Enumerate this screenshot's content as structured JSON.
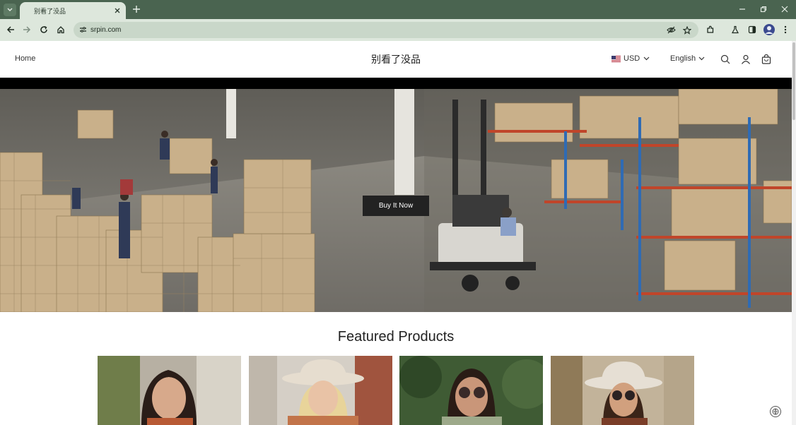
{
  "browser": {
    "tab_title": "别看了没品",
    "url": "srpin.com",
    "icons": [
      "tab-list-icon",
      "close-icon",
      "new-tab-icon",
      "minimize-icon",
      "restore-icon",
      "window-close-icon",
      "back-icon",
      "forward-icon",
      "reload-icon",
      "home-icon",
      "site-info-icon",
      "eye-off-icon",
      "star-icon",
      "extensions-icon",
      "labs-icon",
      "sidebar-icon",
      "profile-icon",
      "menu-icon"
    ]
  },
  "header": {
    "home_label": "Home",
    "logo": "别看了没品",
    "currency": "USD",
    "language": "English",
    "icons": [
      "search-icon",
      "account-icon",
      "cart-icon"
    ]
  },
  "hero": {
    "button_label": "Buy It Now"
  },
  "featured": {
    "title": "Featured Products",
    "products": [
      {
        "name": "product-1"
      },
      {
        "name": "product-2"
      },
      {
        "name": "product-3"
      },
      {
        "name": "product-4"
      }
    ]
  },
  "colors": {
    "chrome_dark": "#4a6450",
    "chrome_light": "#dde7dc",
    "button_dark": "#222222"
  }
}
